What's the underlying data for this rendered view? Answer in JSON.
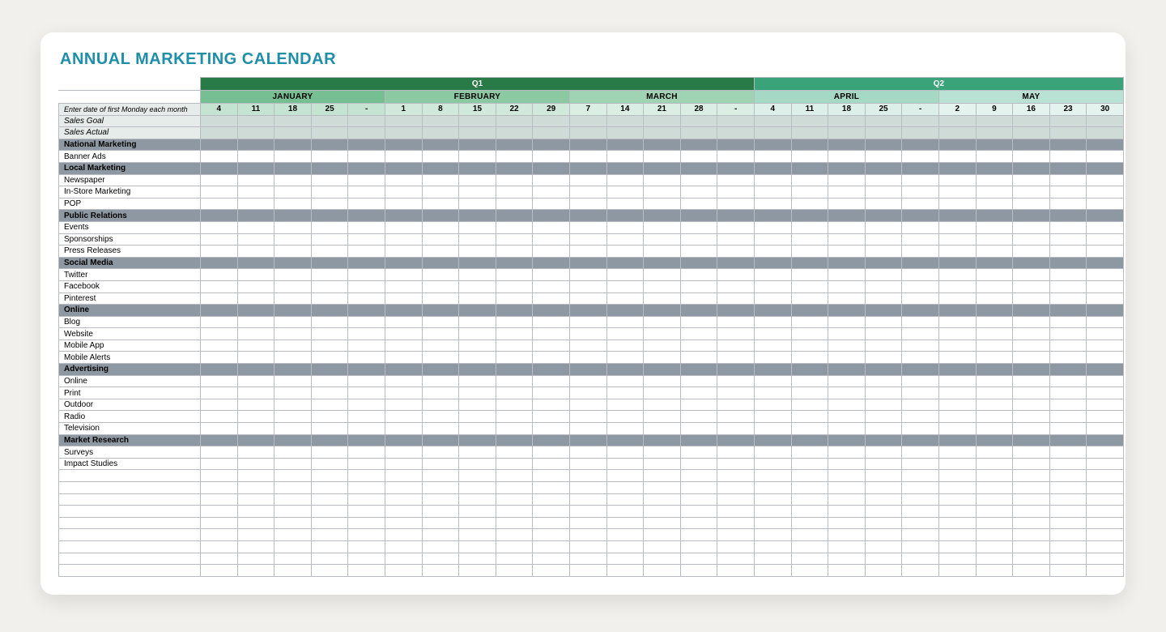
{
  "title": "ANNUAL MARKETING CALENDAR",
  "date_hint": "Enter date of first Monday each month",
  "quarters": [
    {
      "label": "Q1",
      "span": 15,
      "cls": "q1"
    },
    {
      "label": "Q2",
      "span": 10,
      "cls": "q2"
    }
  ],
  "months": [
    {
      "label": "JANUARY",
      "span": 5,
      "cls": "m-jan",
      "dates": [
        "4",
        "11",
        "18",
        "25",
        "-"
      ]
    },
    {
      "label": "FEBRUARY",
      "span": 5,
      "cls": "m-feb",
      "dates": [
        "1",
        "8",
        "15",
        "22",
        "29"
      ]
    },
    {
      "label": "MARCH",
      "span": 5,
      "cls": "m-mar",
      "dates": [
        "7",
        "14",
        "21",
        "28",
        "-"
      ]
    },
    {
      "label": "APRIL",
      "span": 5,
      "cls": "m-apr",
      "dates": [
        "4",
        "11",
        "18",
        "25",
        "-"
      ]
    },
    {
      "label": "MAY",
      "span": 5,
      "cls": "m-may",
      "dates": [
        "2",
        "9",
        "16",
        "23",
        "30"
      ]
    }
  ],
  "rows": [
    {
      "label": "Sales Goal",
      "type": "italic"
    },
    {
      "label": "Sales Actual",
      "type": "italic"
    },
    {
      "label": "National Marketing",
      "type": "cat"
    },
    {
      "label": "Banner Ads",
      "type": "item"
    },
    {
      "label": "Local Marketing",
      "type": "cat"
    },
    {
      "label": "Newspaper",
      "type": "item"
    },
    {
      "label": "In-Store Marketing",
      "type": "item"
    },
    {
      "label": "POP",
      "type": "item"
    },
    {
      "label": "Public Relations",
      "type": "cat"
    },
    {
      "label": "Events",
      "type": "item"
    },
    {
      "label": "Sponsorships",
      "type": "item"
    },
    {
      "label": "Press Releases",
      "type": "item"
    },
    {
      "label": "Social Media",
      "type": "cat"
    },
    {
      "label": "Twitter",
      "type": "item"
    },
    {
      "label": "Facebook",
      "type": "item"
    },
    {
      "label": "Pinterest",
      "type": "item"
    },
    {
      "label": "Online",
      "type": "cat"
    },
    {
      "label": "Blog",
      "type": "item"
    },
    {
      "label": "Website",
      "type": "item"
    },
    {
      "label": "Mobile App",
      "type": "item"
    },
    {
      "label": "Mobile Alerts",
      "type": "item"
    },
    {
      "label": "Advertising",
      "type": "cat"
    },
    {
      "label": "Online",
      "type": "item"
    },
    {
      "label": "Print",
      "type": "item"
    },
    {
      "label": "Outdoor",
      "type": "item"
    },
    {
      "label": "Radio",
      "type": "item"
    },
    {
      "label": "Television",
      "type": "item"
    },
    {
      "label": "Market Research",
      "type": "cat"
    },
    {
      "label": "Surveys",
      "type": "item"
    },
    {
      "label": "Impact Studies",
      "type": "item"
    },
    {
      "label": "",
      "type": "blank"
    },
    {
      "label": "",
      "type": "blank"
    },
    {
      "label": "",
      "type": "blank"
    },
    {
      "label": "",
      "type": "blank"
    },
    {
      "label": "",
      "type": "blank"
    },
    {
      "label": "",
      "type": "blank"
    },
    {
      "label": "",
      "type": "blank"
    },
    {
      "label": "",
      "type": "blank"
    },
    {
      "label": "",
      "type": "blank"
    }
  ]
}
